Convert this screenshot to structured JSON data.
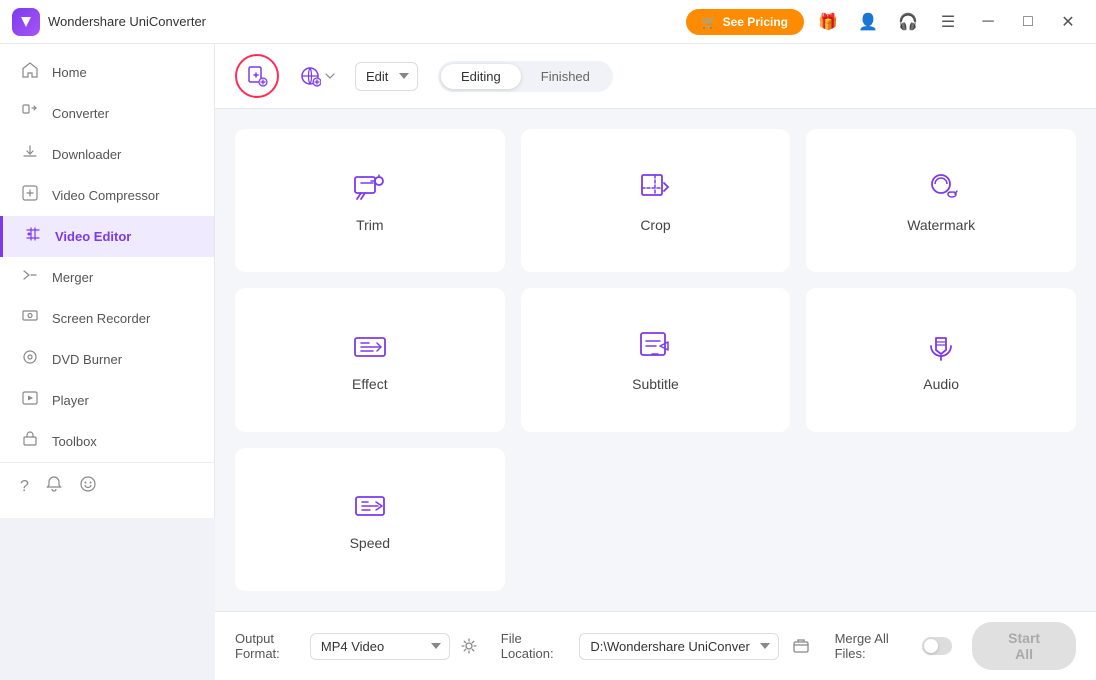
{
  "titleBar": {
    "appName": "Wondershare UniConverter",
    "pricingLabel": "See Pricing",
    "windowControls": {
      "menu": "☰",
      "minimize": "─",
      "maximize": "□",
      "close": "✕"
    }
  },
  "sidebar": {
    "items": [
      {
        "id": "home",
        "label": "Home",
        "icon": "🏠"
      },
      {
        "id": "converter",
        "label": "Converter",
        "icon": "📥"
      },
      {
        "id": "downloader",
        "label": "Downloader",
        "icon": "📥"
      },
      {
        "id": "video-compressor",
        "label": "Video Compressor",
        "icon": "📦"
      },
      {
        "id": "video-editor",
        "label": "Video Editor",
        "icon": "✂️",
        "active": true
      },
      {
        "id": "merger",
        "label": "Merger",
        "icon": "🔗"
      },
      {
        "id": "screen-recorder",
        "label": "Screen Recorder",
        "icon": "📷"
      },
      {
        "id": "dvd-burner",
        "label": "DVD Burner",
        "icon": "💿"
      },
      {
        "id": "player",
        "label": "Player",
        "icon": "▶️"
      },
      {
        "id": "toolbox",
        "label": "Toolbox",
        "icon": "🧰"
      }
    ],
    "bottomIcons": [
      "?",
      "🔔",
      "😊"
    ]
  },
  "toolbar": {
    "addFileLabel": "",
    "addUrlLabel": "",
    "formatOptions": [
      "Edit"
    ],
    "selectedFormat": "Edit",
    "tabs": [
      {
        "id": "editing",
        "label": "Editing",
        "active": true
      },
      {
        "id": "finished",
        "label": "Finished",
        "active": false
      }
    ]
  },
  "editorCards": [
    {
      "id": "trim",
      "label": "Trim",
      "iconType": "trim"
    },
    {
      "id": "crop",
      "label": "Crop",
      "iconType": "crop"
    },
    {
      "id": "watermark",
      "label": "Watermark",
      "iconType": "watermark"
    },
    {
      "id": "effect",
      "label": "Effect",
      "iconType": "effect"
    },
    {
      "id": "subtitle",
      "label": "Subtitle",
      "iconType": "subtitle"
    },
    {
      "id": "audio",
      "label": "Audio",
      "iconType": "audio"
    },
    {
      "id": "speed",
      "label": "Speed",
      "iconType": "speed"
    }
  ],
  "bottomBar": {
    "outputFormatLabel": "Output Format:",
    "outputFormat": "MP4 Video",
    "fileLocationLabel": "File Location:",
    "fileLocation": "D:\\Wondershare UniConverter",
    "mergeAllLabel": "Merge All Files:",
    "startAllLabel": "Start All"
  }
}
